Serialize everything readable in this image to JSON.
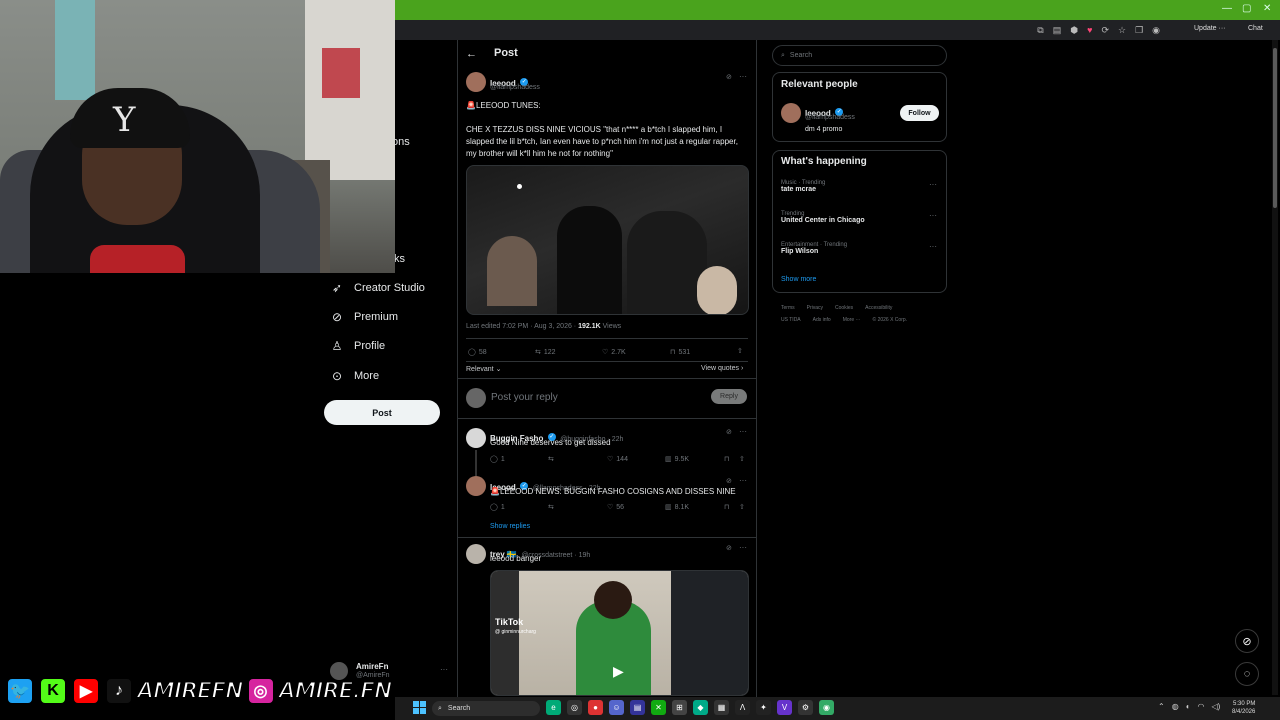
{
  "browser": {
    "update_label": "Update",
    "chat_label": "Chat"
  },
  "sidebar": {
    "fragment_ons": "ons",
    "fragment_ks": "ks",
    "items": [
      {
        "label": "Creator Studio",
        "icon": "rocket-icon"
      },
      {
        "label": "Premium",
        "icon": "premium-check-icon"
      },
      {
        "label": "Profile",
        "icon": "person-icon"
      },
      {
        "label": "More",
        "icon": "more-circle-icon"
      }
    ],
    "post_button": "Post",
    "account": {
      "name": "AmireFn",
      "handle": "@AmireFn"
    }
  },
  "header": {
    "title": "Post"
  },
  "main_post": {
    "name": "leeood",
    "handle": "@llampshadess",
    "line1": "🚨LEEOOD TUNES:",
    "line2": "CHE X TEZZUS DISS NINE VICIOUS  \"that n**** a b*tch I slapped him, I slapped the lil b*tch, Ian even have to p*nch him i'm not just a regular rapper, my brother will k*ll him he not for nothing\"",
    "edited": "Last edited 7:02 PM · Aug 3, 2026 · ",
    "views_count": "192.1K",
    "views_label": " Views",
    "stats": {
      "replies": "58",
      "reposts": "122",
      "likes": "2.7K",
      "bookmarks": "531"
    },
    "relevant_label": "Relevant",
    "view_quotes": "View quotes"
  },
  "composer": {
    "placeholder": "Post your reply",
    "reply_button": "Reply"
  },
  "replies": [
    {
      "name": "Buggin Fasho",
      "meta": "@bugginfasho · 22h",
      "text": "Good Nine deserves to get dissed",
      "r": "1",
      "l": "144",
      "v": "9.5K"
    },
    {
      "name": "leeood",
      "meta": "@llampshadess · 22h",
      "text": "🚨LEEOOD NEWS: BUGGIN FASHO COSIGNS AND DISSES NINE",
      "r": "1",
      "l": "56",
      "v": "8.1K"
    },
    {
      "name": "trey 🇸🇪",
      "meta": "@crossdatstreet · 19h",
      "text": "leeood banger"
    }
  ],
  "show_replies": "Show replies",
  "tiktok": {
    "brand": "TikTok",
    "user": "@ ginminnurcharg"
  },
  "right": {
    "search_placeholder": "Search",
    "relevant_title": "Relevant people",
    "person": {
      "name": "leeood",
      "handle": "@llampshadess",
      "bio": "dm 4 promo",
      "follow": "Follow"
    },
    "happening_title": "What's happening",
    "trends": [
      {
        "meta": "Music · Trending",
        "name": "tate mcrae"
      },
      {
        "meta": "Trending",
        "name": "United Center in Chicago"
      },
      {
        "meta": "Entertainment · Trending",
        "name": "Flip Wilson"
      }
    ],
    "show_more": "Show more",
    "footer1": [
      "Terms",
      "Privacy",
      "Cookies",
      "Accessibility"
    ],
    "footer2": [
      "US TIDA",
      "Ads info",
      "More ···",
      "© 2026 X Corp."
    ]
  },
  "taskbar": {
    "search": "Search",
    "time": "5:30 PM",
    "date": "8/4/2026"
  },
  "overlay": {
    "handle1": "AMIREFN",
    "handle2": "AMIRE.FN"
  },
  "colors": {
    "accent": "#1d9bf0",
    "bar_green": "#4aa31d",
    "twitter": "#1da1f2",
    "kick": "#53fc18",
    "youtube": "#ff0000",
    "instagram": "#d6249f"
  }
}
